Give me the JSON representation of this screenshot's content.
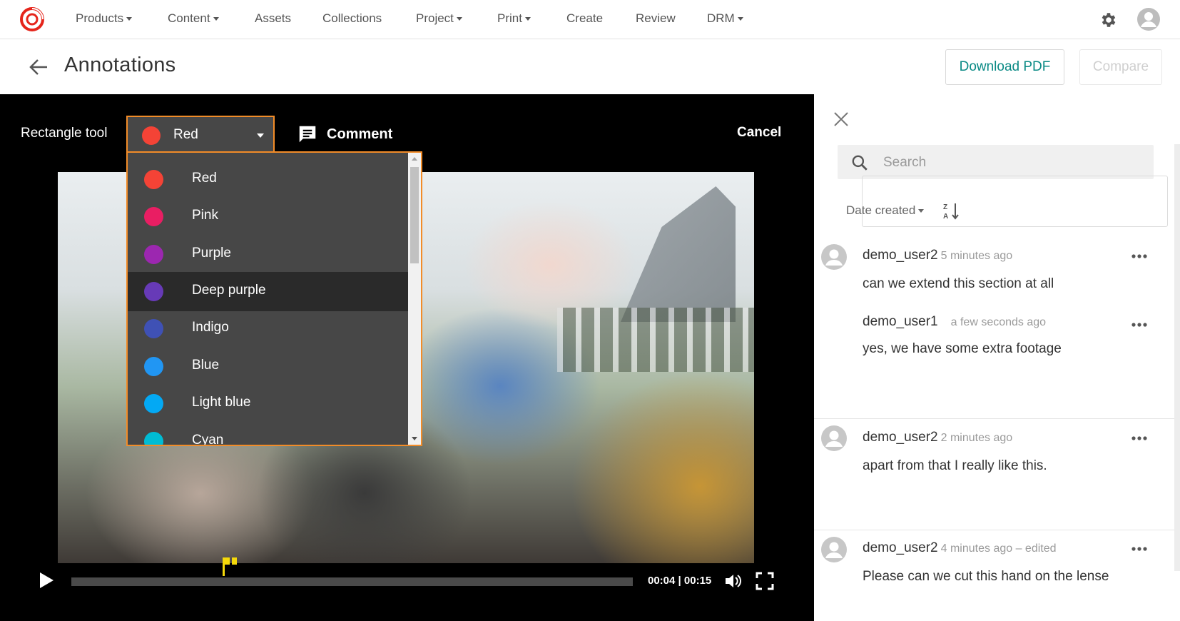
{
  "nav": {
    "items": [
      {
        "label": "Products",
        "dropdown": true
      },
      {
        "label": "Content",
        "dropdown": true
      },
      {
        "label": "Assets",
        "dropdown": false
      },
      {
        "label": "Collections",
        "dropdown": false
      },
      {
        "label": "Project",
        "dropdown": true
      },
      {
        "label": "Print",
        "dropdown": true
      },
      {
        "label": "Create",
        "dropdown": false
      },
      {
        "label": "Review",
        "dropdown": false
      },
      {
        "label": "DRM",
        "dropdown": true
      }
    ],
    "icons": [
      "app-logo-icon",
      "gear-icon",
      "user-avatar-icon"
    ]
  },
  "header": {
    "title": "Annotations",
    "download_label": "Download PDF",
    "compare_label": "Compare"
  },
  "toolbar": {
    "tool_label": "Rectangle tool",
    "selected_color": {
      "name": "Red",
      "hex": "#f44336"
    },
    "comment_label": "Comment",
    "cancel_label": "Cancel"
  },
  "color_menu": {
    "highlighted": "Deep purple",
    "options": [
      {
        "name": "Red",
        "hex": "#f44336"
      },
      {
        "name": "Pink",
        "hex": "#e91e63"
      },
      {
        "name": "Purple",
        "hex": "#9c27b0"
      },
      {
        "name": "Deep purple",
        "hex": "#673ab7"
      },
      {
        "name": "Indigo",
        "hex": "#3f51b5"
      },
      {
        "name": "Blue",
        "hex": "#2196f3"
      },
      {
        "name": "Light blue",
        "hex": "#03a9f4"
      },
      {
        "name": "Cyan",
        "hex": "#00bcd4"
      }
    ]
  },
  "player": {
    "current_time": "00:04",
    "duration": "00:15",
    "time_display": "00:04 | 00:15",
    "marker_color": "#f5d90a"
  },
  "sidebar": {
    "search_placeholder": "Search",
    "sort_label": "Date created",
    "comments": [
      {
        "user": "demo_user2",
        "time": "5 minutes ago",
        "text": "can we extend this section at all",
        "reply": {
          "user": "demo_user1",
          "time": "a few seconds ago",
          "text": "yes, we have some extra footage"
        }
      },
      {
        "user": "demo_user2",
        "time": "2 minutes ago",
        "text": "apart from that I really like this."
      },
      {
        "user": "demo_user2",
        "time": "4 minutes ago – edited",
        "text": "Please can we cut this hand on the lense"
      }
    ]
  },
  "colors": {
    "accent_orange": "#f28c28",
    "teal_link": "#0a8a85",
    "brand_red": "#e5251b"
  }
}
